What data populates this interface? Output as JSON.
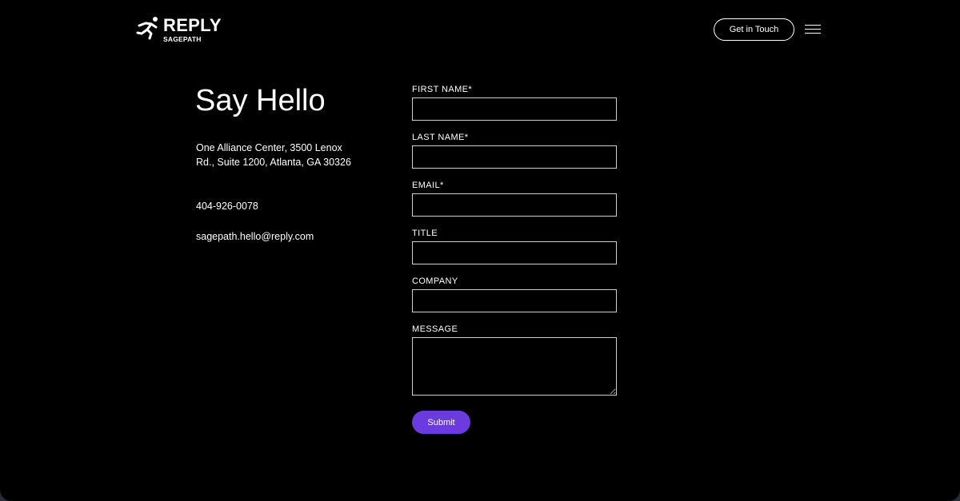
{
  "header": {
    "logo_word": "REPLY",
    "logo_sub": "SAGEPATH",
    "cta_label": "Get in Touch",
    "menu_icon": "hamburger-menu-icon"
  },
  "contact": {
    "heading": "Say Hello",
    "address": "One Alliance Center, 3500 Lenox Rd., Suite 1200, Atlanta, GA 30326",
    "phone": "404-926-0078",
    "email": "sagepath.hello@reply.com"
  },
  "form": {
    "fields": [
      {
        "label": "FIRST NAME*",
        "value": ""
      },
      {
        "label": "LAST NAME*",
        "value": ""
      },
      {
        "label": "EMAIL*",
        "value": ""
      },
      {
        "label": "TITLE",
        "value": ""
      },
      {
        "label": "COMPANY",
        "value": ""
      },
      {
        "label": "MESSAGE",
        "value": ""
      }
    ],
    "submit_label": "Submit"
  },
  "colors": {
    "background": "#000000",
    "text": "#ffffff",
    "accent": "#6b3be0"
  }
}
